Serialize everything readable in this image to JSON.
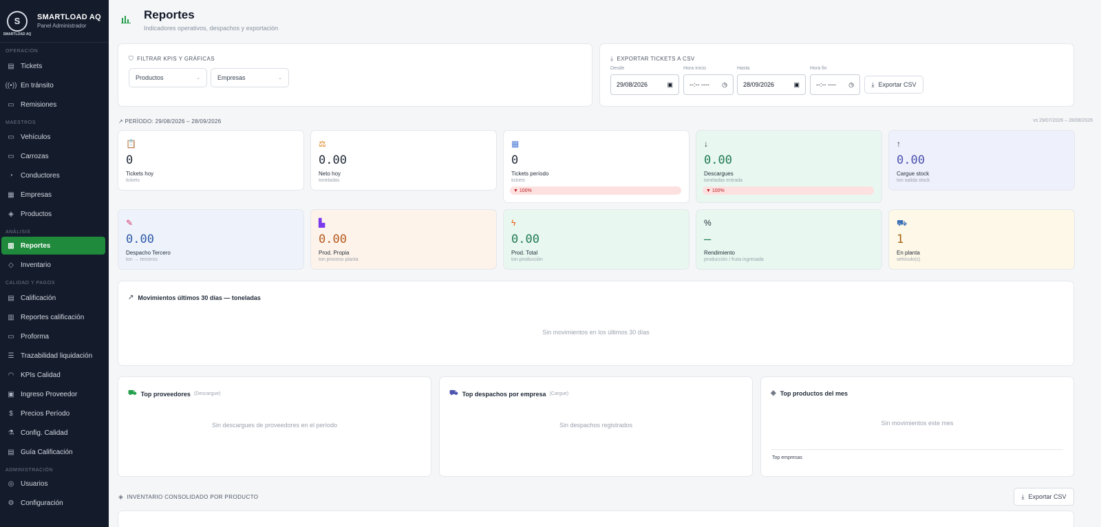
{
  "brand": {
    "name": "SMARTLOAD AQ",
    "subtitle": "Panel Administrador",
    "logo_letter": "S",
    "logo_text": "SMARTLOAD AQ"
  },
  "sidebar": {
    "sections": {
      "operacion": "OPERACIÓN",
      "maestros": "MAESTROS",
      "analisis": "ANÁLISIS",
      "calidad": "CALIDAD Y PAGOS",
      "admin": "ADMINISTRACIÓN"
    },
    "items": [
      {
        "label": "Tickets",
        "icon": "clipboard-icon"
      },
      {
        "label": "En tránsito",
        "icon": "signal-icon"
      },
      {
        "label": "Remisiones",
        "icon": "document-icon"
      },
      {
        "label": "Vehículos",
        "icon": "truck-icon"
      },
      {
        "label": "Carrozas",
        "icon": "trailer-icon"
      },
      {
        "label": "Conductores",
        "icon": "users-icon"
      },
      {
        "label": "Empresas",
        "icon": "building-icon"
      },
      {
        "label": "Productos",
        "icon": "package-icon"
      },
      {
        "label": "Reportes",
        "icon": "bar-chart-icon",
        "active": true
      },
      {
        "label": "Inventario",
        "icon": "layers-icon"
      },
      {
        "label": "Calificación",
        "icon": "clipboard-check-icon"
      },
      {
        "label": "Reportes calificación",
        "icon": "bar-chart-icon"
      },
      {
        "label": "Proforma",
        "icon": "file-icon"
      },
      {
        "label": "Trazabilidad liquidación",
        "icon": "sliders-icon"
      },
      {
        "label": "KPIs Calidad",
        "icon": "gauge-icon"
      },
      {
        "label": "Ingreso Proveedor",
        "icon": "inbox-icon"
      },
      {
        "label": "Precios Período",
        "icon": "dollar-icon"
      },
      {
        "label": "Config. Calidad",
        "icon": "flask-icon"
      },
      {
        "label": "Guía Calificación",
        "icon": "book-icon"
      },
      {
        "label": "Usuarios",
        "icon": "shield-icon"
      },
      {
        "label": "Configuración",
        "icon": "gear-icon"
      }
    ]
  },
  "header": {
    "title": "Reportes",
    "subtitle": "Indicadores operativos, despachos y exportación"
  },
  "filters": {
    "label": "FILTRAR KPIS Y GRÁFICAS",
    "products": "Productos",
    "companies": "Empresas"
  },
  "export": {
    "label": "EXPORTAR TICKETS A CSV",
    "from_label": "Desde",
    "from_value": "29/08/2026",
    "start_time_label": "Hora inicio",
    "start_time_value": "--:-- ----",
    "to_label": "Hasta",
    "to_value": "28/09/2026",
    "end_time_label": "Hora fin",
    "end_time_value": "--:-- ----",
    "button": "Exportar CSV"
  },
  "period": {
    "label": "PERÍODO: 29/08/2026 – 28/09/2026",
    "compare": "vs 29/07/2026 – 28/08/2026"
  },
  "kpis": [
    {
      "value": "0",
      "label": "Tickets hoy",
      "sub": "tickets",
      "icon": "clipboard-icon",
      "bg": "#ffffff",
      "color": "#1f2937"
    },
    {
      "value": "0.00",
      "label": "Neto hoy",
      "sub": "toneladas",
      "icon": "scale-icon",
      "bg": "#ffffff",
      "color": "#1f2937"
    },
    {
      "value": "0",
      "label": "Tickets período",
      "sub": "tickets",
      "icon": "calendar-icon",
      "bg": "#ffffff",
      "color": "#1f2937",
      "badge": "▼ 100%"
    },
    {
      "value": "0.00",
      "label": "Descargues",
      "sub": "toneladas entrada",
      "icon": "arrow-down-icon",
      "bg": "#e8f7ef",
      "color": "#1f7a55",
      "badge": "▼ 100%"
    },
    {
      "value": "0.00",
      "label": "Cargue stock",
      "sub": "ton salida stock",
      "icon": "arrow-up-icon",
      "bg": "#eef0fb",
      "color": "#4c53b0"
    },
    {
      "value": "0.00",
      "label": "Despacho Tercero",
      "sub": "ton → terceros",
      "icon": "syringe-icon",
      "bg": "#eef3fb",
      "color": "#2f5aa8"
    },
    {
      "value": "0.00",
      "label": "Prod. Propia",
      "sub": "ton proceso planta",
      "icon": "factory-icon",
      "bg": "#fdf3ea",
      "color": "#b55a1f"
    },
    {
      "value": "0.00",
      "label": "Prod. Total",
      "sub": "ton producción",
      "icon": "bolt-icon",
      "bg": "#e8f7ef",
      "color": "#1f7a55"
    },
    {
      "value": "—",
      "label": "Rendimiento",
      "sub": "producción / fruta ingresada",
      "icon": "percent-icon",
      "bg": "#e8f7ef",
      "color": "#1f7a55"
    },
    {
      "value": "1",
      "label": "En planta",
      "sub": "vehículo(s)",
      "icon": "truck-icon",
      "bg": "#fdf8e8",
      "color": "#a8620f"
    }
  ],
  "movements": {
    "title": "Movimientos últimos 30 días — toneladas",
    "empty": "Sin movimientos en los últimos 30 días"
  },
  "top_suppliers": {
    "title": "Top proveedores",
    "note": "(Descargue)",
    "empty": "Sin descargues de proveedores en el período"
  },
  "top_dispatches": {
    "title": "Top despachos por empresa",
    "note": "(Cargue)",
    "empty": "Sin despachos registrados"
  },
  "top_products": {
    "title": "Top productos del mes",
    "empty": "Sin movimientos este mes",
    "companies_label": "Top empresas"
  },
  "inventory": {
    "label": "INVENTARIO CONSOLIDADO POR PRODUCTO",
    "button": "Exportar CSV"
  }
}
